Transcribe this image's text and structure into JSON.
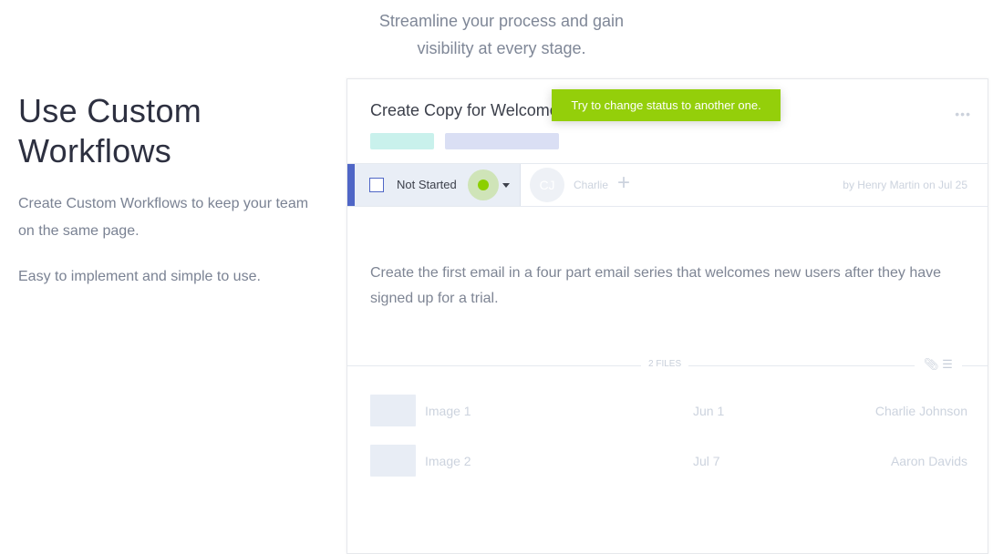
{
  "intro": {
    "text_line1": "Streamline your process and gain",
    "text_line2": "visibility at every stage."
  },
  "left": {
    "title_line1": "Use Custom",
    "title_line2": "Workflows",
    "paragraph1": "Create Custom Workflows to keep your team on the same page.",
    "paragraph2": "Easy to implement and simple to use."
  },
  "card": {
    "title": "Create Copy for Welcome Email",
    "more_icon": "ellipsis-icon",
    "more_glyph": "•••",
    "status": {
      "label": "Not Started",
      "checked": false
    },
    "assignee": {
      "initials": "CJ",
      "name": "Charlie"
    },
    "add_glyph": "+",
    "byline": "by Henry Martin on Jul 25",
    "description": "Create the first email in a four part email series that welcomes new users after they have signed up for a trial.",
    "files_label": "2 FILES",
    "files_icons": "⌀ ☰",
    "files": [
      {
        "name": "Image 1",
        "date": "Jun 1",
        "owner": "Charlie Johnson"
      },
      {
        "name": "Image 2",
        "date": "Jul 7",
        "owner": "Aaron Davids"
      }
    ]
  },
  "tooltip": {
    "text": "Try to change status to another one."
  },
  "colors": {
    "accent": "#4f66c6",
    "tooltip": "#94cf0a",
    "pulse": "#8ccf00"
  }
}
